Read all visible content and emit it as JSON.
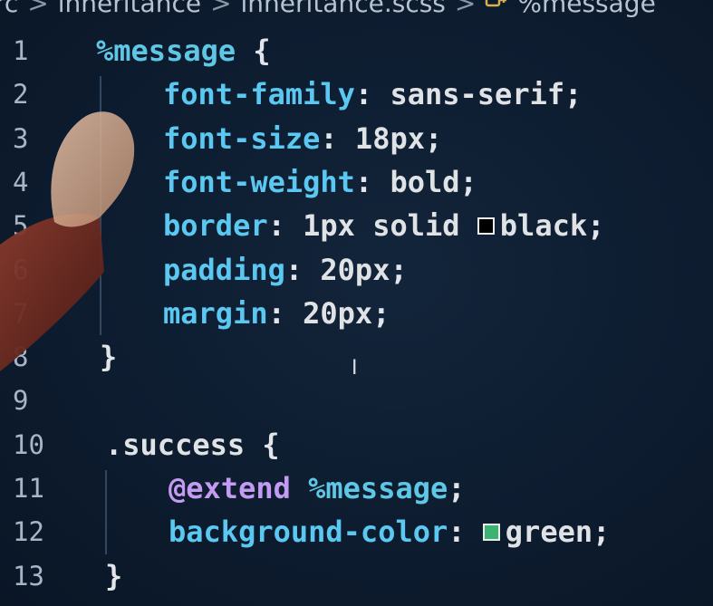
{
  "breadcrumb": {
    "items": [
      "rc",
      "inheritance",
      "inheritance.scss",
      "%message"
    ],
    "separator": ">",
    "symbol_icon": "symbol-key-icon"
  },
  "editor": {
    "lines": [
      {
        "num": "1",
        "tokens": [
          {
            "t": "%message",
            "c": "sel"
          },
          {
            "t": " {",
            "c": "punc"
          }
        ]
      },
      {
        "num": "2",
        "tokens": [
          {
            "t": "font-family",
            "c": "prop"
          },
          {
            "t": ": ",
            "c": "punc"
          },
          {
            "t": "sans-serif",
            "c": "val"
          },
          {
            "t": ";",
            "c": "punc"
          }
        ]
      },
      {
        "num": "3",
        "tokens": [
          {
            "t": "font-size",
            "c": "prop"
          },
          {
            "t": ": ",
            "c": "punc"
          },
          {
            "t": "18px",
            "c": "val"
          },
          {
            "t": ";",
            "c": "punc"
          }
        ]
      },
      {
        "num": "4",
        "tokens": [
          {
            "t": "font-weight",
            "c": "prop"
          },
          {
            "t": ": ",
            "c": "punc"
          },
          {
            "t": "bold",
            "c": "val"
          },
          {
            "t": ";",
            "c": "punc"
          }
        ]
      },
      {
        "num": "5",
        "tokens": [
          {
            "t": "border",
            "c": "prop"
          },
          {
            "t": ": ",
            "c": "punc"
          },
          {
            "t": "1px solid ",
            "c": "val"
          },
          {
            "swatch": "#000000"
          },
          {
            "t": "black",
            "c": "val"
          },
          {
            "t": ";",
            "c": "punc"
          }
        ]
      },
      {
        "num": "6",
        "tokens": [
          {
            "t": "padding",
            "c": "prop"
          },
          {
            "t": ": ",
            "c": "punc"
          },
          {
            "t": "20px",
            "c": "val"
          },
          {
            "t": ";",
            "c": "punc"
          }
        ]
      },
      {
        "num": "7",
        "tokens": [
          {
            "t": "margin",
            "c": "prop"
          },
          {
            "t": ": ",
            "c": "punc"
          },
          {
            "t": "20px",
            "c": "val"
          },
          {
            "t": ";",
            "c": "punc"
          }
        ]
      },
      {
        "num": "8",
        "tokens": [
          {
            "t": "}",
            "c": "punc"
          }
        ]
      },
      {
        "num": "9",
        "tokens": []
      },
      {
        "num": "10",
        "tokens": [
          {
            "t": ".success",
            "c": "val"
          },
          {
            "t": " {",
            "c": "punc"
          }
        ]
      },
      {
        "num": "11",
        "tokens": [
          {
            "t": "@extend",
            "c": "atr"
          },
          {
            "t": " ",
            "c": "punc"
          },
          {
            "t": "%message",
            "c": "sel"
          },
          {
            "t": ";",
            "c": "punc"
          }
        ]
      },
      {
        "num": "12",
        "tokens": [
          {
            "t": "background-color",
            "c": "prop"
          },
          {
            "t": ": ",
            "c": "punc"
          },
          {
            "swatch": "#3cb371"
          },
          {
            "t": "green",
            "c": "val"
          },
          {
            "t": ";",
            "c": "punc"
          }
        ]
      },
      {
        "num": "13",
        "tokens": [
          {
            "t": "}",
            "c": "punc"
          }
        ]
      }
    ]
  },
  "colors": {
    "background": "#0d1c2f",
    "selector": "#5fc7e6",
    "property": "#5ac8f0",
    "value": "#e0e3e6",
    "at_rule": "#c39bf2"
  }
}
